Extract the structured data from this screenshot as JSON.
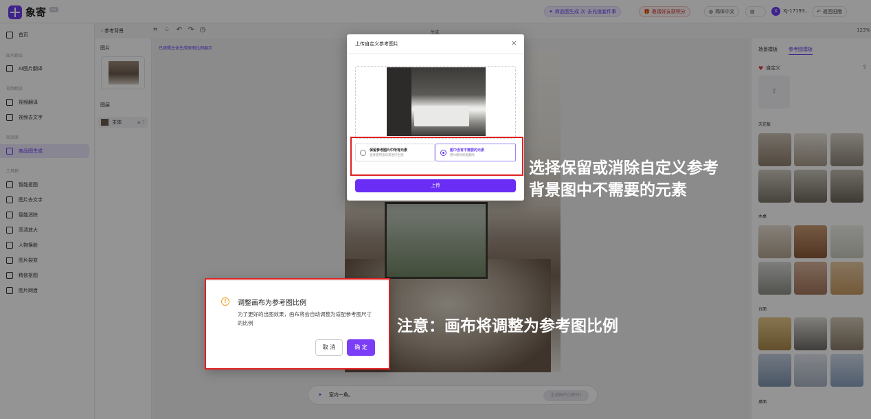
{
  "app": {
    "name": "象寄",
    "badge": "AI"
  },
  "topbar": {
    "promo_text": "商品图生成 次",
    "promo_link": "去充值套件事",
    "invite_text": "邀请好友获积分",
    "lang": "简体中文",
    "notif": "",
    "user_initial": "X",
    "username": "XJ-17193...",
    "back_old": "返回旧版"
  },
  "sidebar": {
    "items": [
      {
        "label": "首页"
      },
      {
        "label": "AI图片翻译"
      },
      {
        "label": "视频翻译"
      },
      {
        "label": "视频去文字"
      },
      {
        "label": "商品图生成"
      },
      {
        "label": "智能抠图"
      },
      {
        "label": "图片去文字"
      },
      {
        "label": "智能消除"
      },
      {
        "label": "高清放大"
      },
      {
        "label": "人物换脸"
      },
      {
        "label": "图片裂变"
      },
      {
        "label": "精修抠图"
      },
      {
        "label": "图片网盘"
      }
    ],
    "groups": [
      "图片翻译",
      "视频翻译",
      "商品图",
      "工具箱"
    ]
  },
  "layer_panel": {
    "back": "参考背景",
    "image_label": "图片",
    "layer_label": "图层",
    "layer_name": "主体"
  },
  "toolbar": {
    "mode": "生成",
    "zoom": "123%"
  },
  "canvas": {
    "hint": "已按照主体生成原图比例展示",
    "prompt": "室内一角。",
    "generate": "生成图片(0积分)"
  },
  "right_panel": {
    "tab_scene": "场景模板",
    "tab_ref": "参考图模板",
    "custom_label": "自定义",
    "categories": [
      "天花板",
      "木桌",
      "台面",
      "桌面"
    ]
  },
  "upload_dialog": {
    "title": "上传自定义参考图片",
    "option_keep_title": "保留参考图片中所有元素",
    "option_keep_sub": "直接使用该场景进行生图",
    "option_remove_title": "图中含有不需要的元素",
    "option_remove_sub": "用AI帮你智能删除",
    "upload_button": "上传"
  },
  "confirm_dialog": {
    "title": "调整画布为参考图比例",
    "body": "为了更好的出图效果，画布将会自动调整为适配参考图尺寸的比例",
    "cancel": "取 消",
    "ok": "确 定"
  },
  "annotations": {
    "callout_1_line1": "选择保留或消除自定义参考",
    "callout_1_line2": "背景图中不需要的元素",
    "callout_2": "注意：画布将调整为参考图比例"
  },
  "colors": {
    "accent": "#6a3df0",
    "highlight_box": "#e02020"
  }
}
